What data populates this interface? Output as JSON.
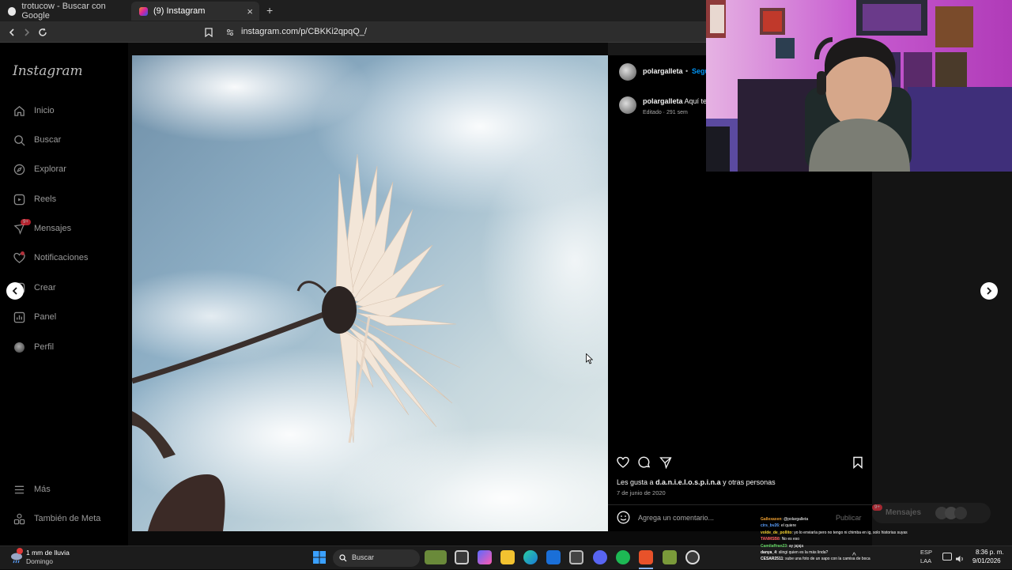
{
  "browser": {
    "tabs": [
      {
        "title": "trotucow - Buscar con Google",
        "color": "#4285f4"
      },
      {
        "title": "(9) Instagram",
        "color": "#d6249f"
      }
    ],
    "new_tab": "+",
    "close": "×",
    "url": "instagram.com/p/CBKKi2qpqQ_/"
  },
  "instagram": {
    "logo": "Instagram",
    "nav": [
      {
        "label": "Inicio",
        "icon": "home-icon"
      },
      {
        "label": "Buscar",
        "icon": "search-icon"
      },
      {
        "label": "Explorar",
        "icon": "explore-icon"
      },
      {
        "label": "Reels",
        "icon": "reels-icon"
      },
      {
        "label": "Mensajes",
        "icon": "messenger-icon",
        "badge": "9+"
      },
      {
        "label": "Notificaciones",
        "icon": "heart-icon"
      },
      {
        "label": "Crear",
        "icon": "plus-square-icon"
      },
      {
        "label": "Panel",
        "icon": "chart-icon"
      },
      {
        "label": "Perfil",
        "icon": "profile-avatar-icon"
      }
    ],
    "more": "Más",
    "meta": "También de Meta",
    "post": {
      "username": "polargalleta",
      "follow": "Seguir",
      "caption_user": "polargalleta",
      "caption_text": "Aquí te",
      "caption_meta": "Editado · 291 sem",
      "likes_prefix": "Les gusta a",
      "likes_user": "d.a.n.i.e.l.o.s.p.i.n.a",
      "likes_suffix": "y otras personas",
      "date": "7 de junio de 2020",
      "comment_placeholder": "Agrega un comentario...",
      "publish": "Publicar"
    },
    "messages_pill": {
      "label": "Mensajes",
      "badge": "9+"
    }
  },
  "chat": [
    {
      "user": "Gallexaxen",
      "text": ": @polargalleta",
      "color": "#f0a030"
    },
    {
      "user": "cirs_bv26",
      "text": ": el quiere",
      "color": "#5aa0ff"
    },
    {
      "user": "volde_de_pollito",
      "text": ": yo lo enviaría pero no tengo ni chimba en ig, solo historias suyas",
      "color": "#f0d030"
    },
    {
      "user": "TANMSB8",
      "text": ": No es eso",
      "color": "#ff6060"
    },
    {
      "user": "Camilaffran23",
      "text": ": ay jajaja",
      "color": "#60d060"
    },
    {
      "user": "danya_4",
      "text": ": slingi quien es la más linda?",
      "color": "#ffffff"
    },
    {
      "user": "CESAR2511",
      "text": ": sube una foto de un sapo con la camisa de boca",
      "color": "#ffffff"
    }
  ],
  "taskbar": {
    "weather_temp": "1 mm de lluvia",
    "weather_day": "Domingo",
    "search": "Buscar",
    "lang_1": "ESP",
    "lang_2": "LAA",
    "time": "8:36 p. m.",
    "date": "9/01/2026"
  }
}
